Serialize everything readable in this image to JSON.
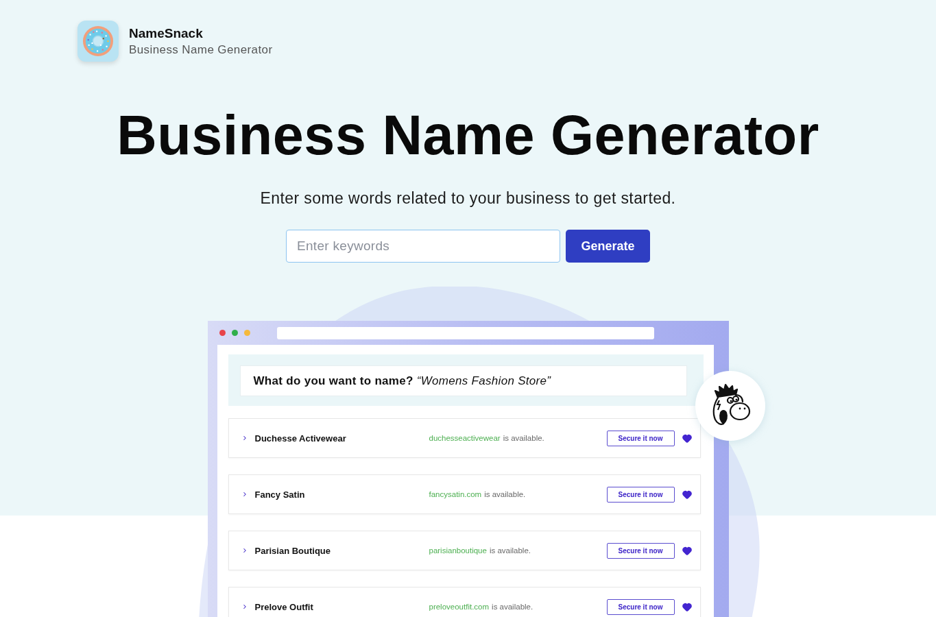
{
  "brand": {
    "name": "NameSnack",
    "tagline": "Business Name Generator"
  },
  "hero": {
    "title": "Business Name Generator",
    "subtitle": "Enter some words related to your business to get started."
  },
  "search": {
    "placeholder": "Enter keywords",
    "button": "Generate"
  },
  "preview": {
    "question": "**What do you want to name?** *“Womens Fashion Store”*",
    "results": [
      {
        "name": "Duchesse Activewear",
        "domain": "duchesseactivewear",
        "status": "is available.",
        "action": "Secure it now"
      },
      {
        "name": "Fancy Satin",
        "domain": "fancysatin.com",
        "status": "is available.",
        "action": "Secure it now"
      },
      {
        "name": "Parisian Boutique",
        "domain": "parisianboutique",
        "status": "is available.",
        "action": "Secure it now"
      },
      {
        "name": "Prelove Outfit",
        "domain": "preloveoutfit.com",
        "status": "is available.",
        "action": "Secure it now"
      }
    ]
  }
}
